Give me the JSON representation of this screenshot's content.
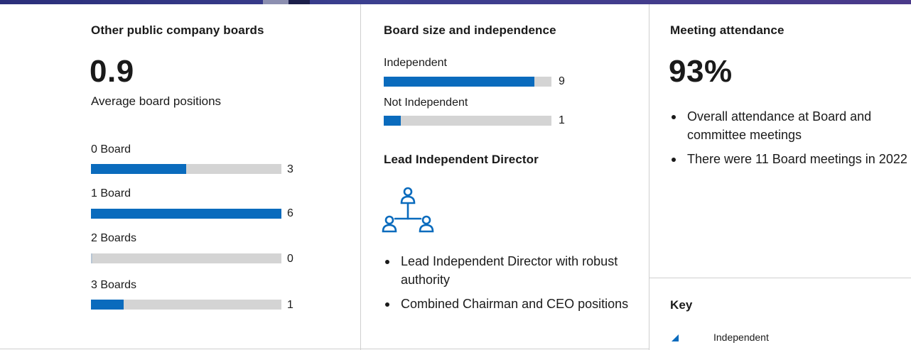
{
  "colors": {
    "accent": "#0a6bbd",
    "track": "#d4d4d4"
  },
  "other_boards": {
    "title": "Other public company boards",
    "big_value": "0.9",
    "big_caption": "Average board positions",
    "bars": [
      {
        "label": "0 Board",
        "count": "3",
        "fraction": 0.5
      },
      {
        "label": "1 Board",
        "count": "6",
        "fraction": 1.0
      },
      {
        "label": "2 Boards",
        "count": "0",
        "fraction": 0.0
      },
      {
        "label": "3 Boards",
        "count": "1",
        "fraction": 0.17
      }
    ]
  },
  "board_size": {
    "title": "Board size and independence",
    "bars": [
      {
        "label": "Independent",
        "count": "9",
        "fraction": 0.9
      },
      {
        "label": "Not Independent",
        "count": "1",
        "fraction": 0.1
      }
    ],
    "lead_title": "Lead Independent Director",
    "lead_icon": "org-chart-people-icon",
    "bullets": [
      "Lead Independent Director with robust authority",
      "Combined Chairman and CEO positions"
    ]
  },
  "attendance": {
    "title": "Meeting attendance",
    "big_value": "93%",
    "bullets": [
      "Overall attendance at Board and committee meetings",
      "There were 11 Board meetings in 2022"
    ]
  },
  "key": {
    "title": "Key",
    "items": [
      {
        "label": "Independent",
        "icon": "triangle-marker-icon"
      }
    ]
  }
}
